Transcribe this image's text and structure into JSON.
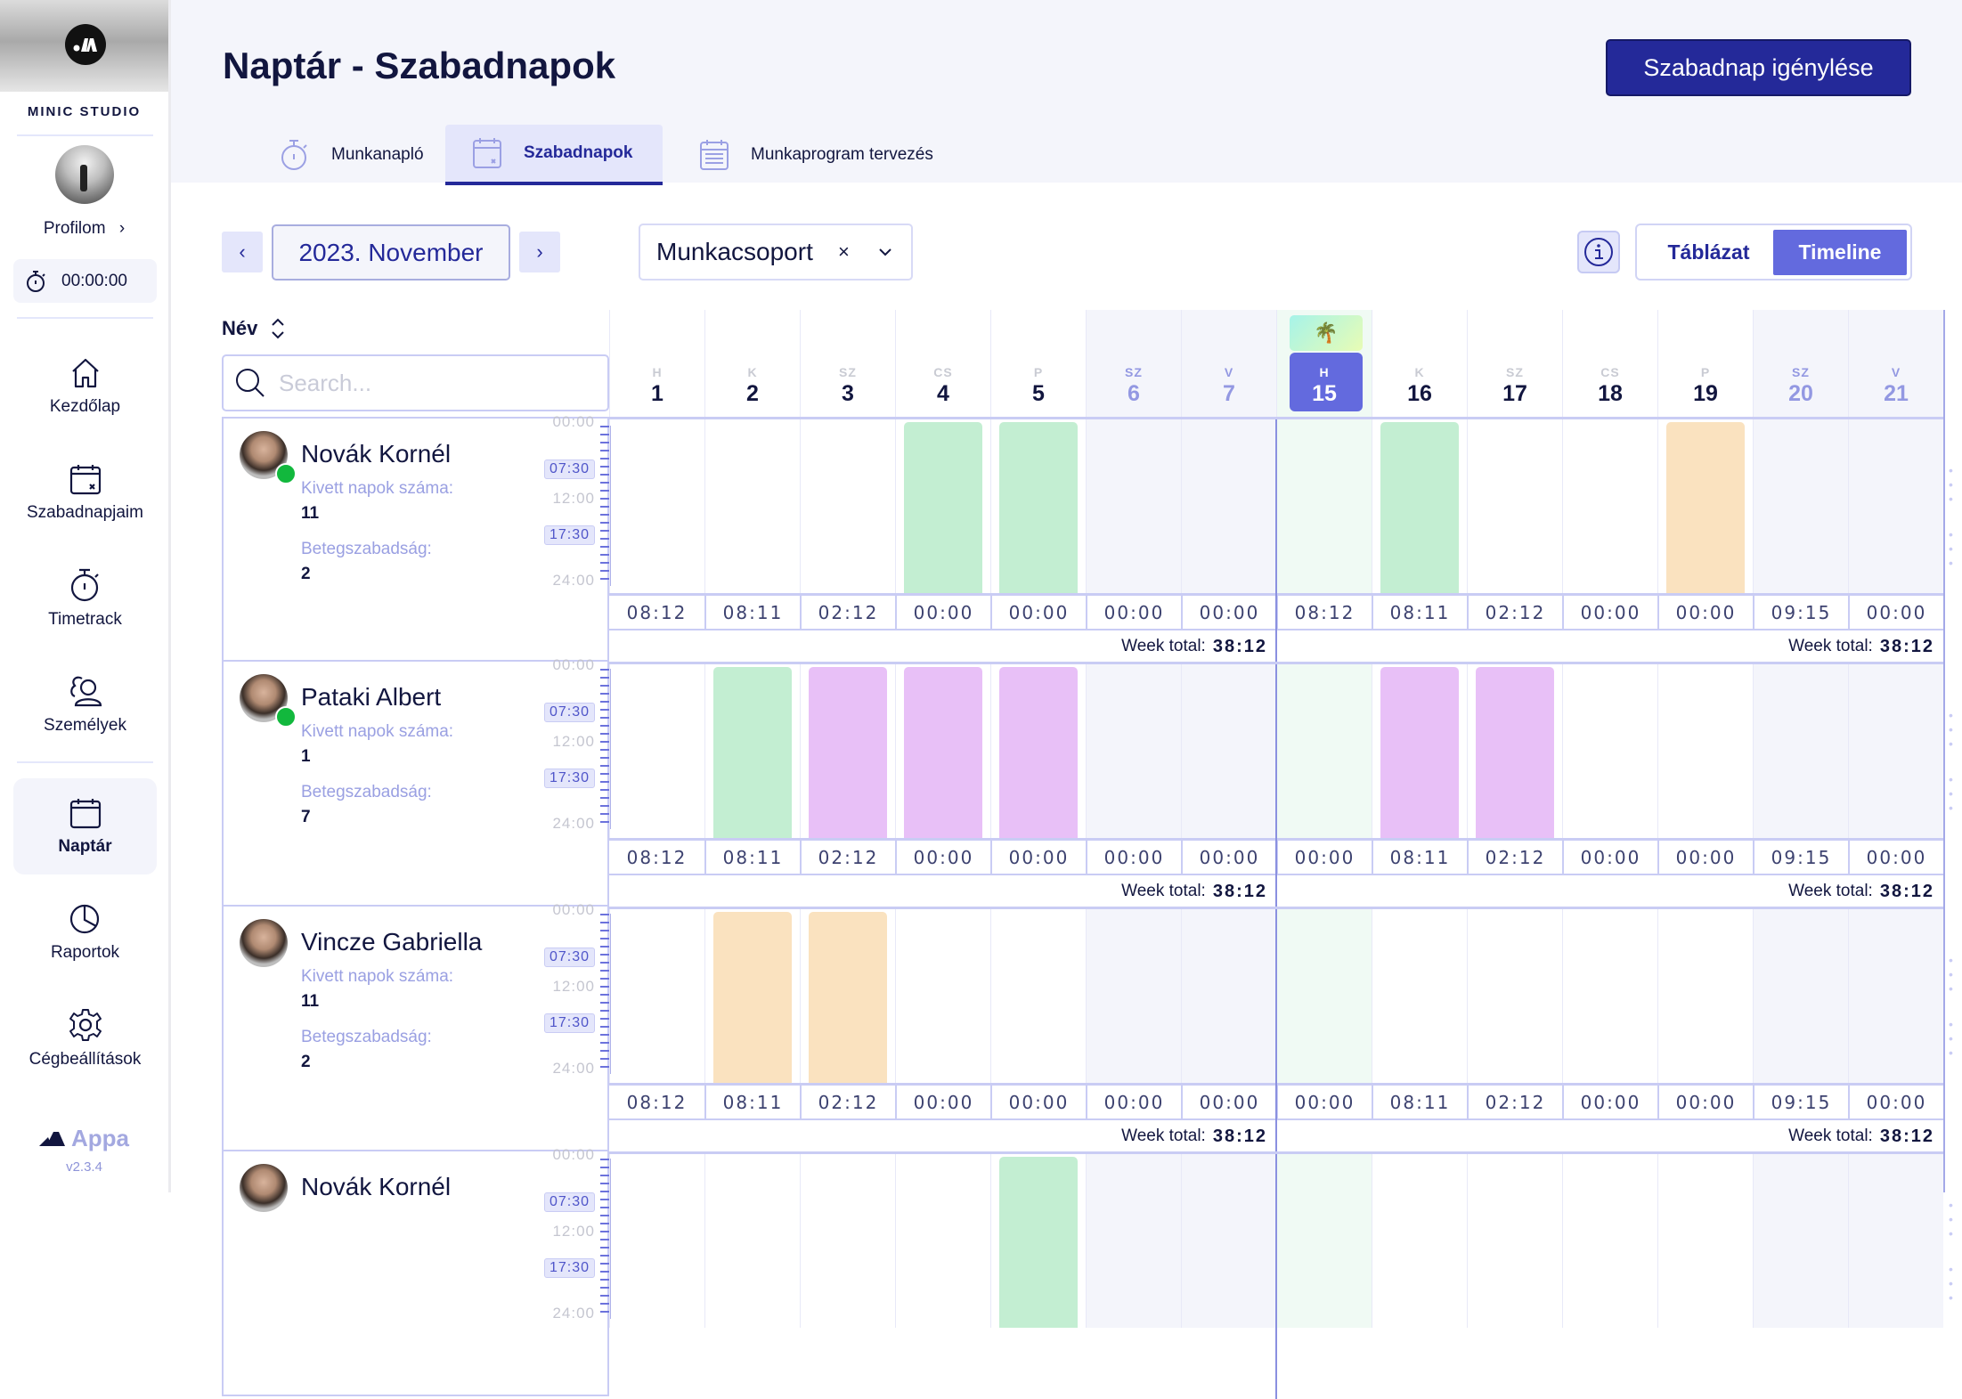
{
  "sidebar": {
    "company": "MINIC STUDIO",
    "profile_label": "Profilom",
    "timer": "00:00:00",
    "nav": [
      {
        "label": "Kezdőlap",
        "icon": "home-icon"
      },
      {
        "label": "Szabadnapjaim",
        "icon": "calendar-x-icon"
      },
      {
        "label": "Timetrack",
        "icon": "stopwatch-icon"
      },
      {
        "label": "Személyek",
        "icon": "people-icon"
      },
      {
        "label": "Naptár",
        "icon": "calendar-icon",
        "active": true
      },
      {
        "label": "Raportok",
        "icon": "pie-chart-icon"
      },
      {
        "label": "Cégbeállítások",
        "icon": "gear-icon"
      }
    ],
    "brand": "Appa",
    "version": "v2.3.4"
  },
  "header": {
    "title": "Naptár - Szabadnapok",
    "primary_button": "Szabadnap igénylése",
    "tabs": [
      {
        "label": "Munkanapló",
        "icon": "stopwatch-icon"
      },
      {
        "label": "Szabadnapok",
        "icon": "calendar-x-icon",
        "active": true
      },
      {
        "label": "Munkaprogram tervezés",
        "icon": "calendar-list-icon"
      }
    ]
  },
  "controls": {
    "prev": "‹",
    "month": "2023. November",
    "next": "›",
    "group_select": "Munkacsoport",
    "group_clear": "×",
    "view_options": [
      "Táblázat",
      "Timeline"
    ],
    "active_view": "Timeline"
  },
  "grid": {
    "name_header": "Név",
    "search_placeholder": "Search...",
    "days": [
      {
        "abbr": "H",
        "num": "1"
      },
      {
        "abbr": "K",
        "num": "2"
      },
      {
        "abbr": "SZ",
        "num": "3"
      },
      {
        "abbr": "CS",
        "num": "4"
      },
      {
        "abbr": "P",
        "num": "5"
      },
      {
        "abbr": "SZ",
        "num": "6",
        "weekend": true
      },
      {
        "abbr": "V",
        "num": "7",
        "weekend": true
      },
      {
        "abbr": "H",
        "num": "15",
        "today": true,
        "holiday": "🌴"
      },
      {
        "abbr": "K",
        "num": "16"
      },
      {
        "abbr": "SZ",
        "num": "17"
      },
      {
        "abbr": "CS",
        "num": "18"
      },
      {
        "abbr": "P",
        "num": "19"
      },
      {
        "abbr": "SZ",
        "num": "20",
        "weekend": true
      },
      {
        "abbr": "V",
        "num": "21",
        "weekend": true
      }
    ],
    "scale": {
      "start": "00:00",
      "mid": "12:00",
      "end": "24:00",
      "work_start": "07:30",
      "work_end": "17:30"
    },
    "week_total_label": "Week total:",
    "leave_colors": {
      "vacation": "#c3eed2",
      "sick": "#fae2bf",
      "other": "#e8c0f7"
    },
    "people": [
      {
        "name": "Novák Kornél",
        "online": true,
        "taken_label": "Kivett napok száma:",
        "taken": "11",
        "sick_label": "Betegszabadság:",
        "sick": "2",
        "bars": [
          "",
          "",
          "",
          "vacation",
          "vacation",
          "",
          "",
          "",
          "vacation",
          "",
          "",
          "sick",
          "",
          ""
        ],
        "hours": [
          "08:12",
          "08:11",
          "02:12",
          "00:00",
          "00:00",
          "00:00",
          "00:00",
          "08:12",
          "08:11",
          "02:12",
          "00:00",
          "00:00",
          "09:15",
          "00:00"
        ],
        "week_totals": [
          "38:12",
          "38:12"
        ]
      },
      {
        "name": "Pataki Albert",
        "online": true,
        "taken_label": "Kivett napok száma:",
        "taken": "1",
        "sick_label": "Betegszabadság:",
        "sick": "7",
        "bars": [
          "",
          "vacation",
          "other",
          "other",
          "other",
          "",
          "",
          "",
          "other",
          "other",
          "",
          "",
          "",
          ""
        ],
        "hours": [
          "08:12",
          "08:11",
          "02:12",
          "00:00",
          "00:00",
          "00:00",
          "00:00",
          "00:00",
          "08:11",
          "02:12",
          "00:00",
          "00:00",
          "09:15",
          "00:00"
        ],
        "week_totals": [
          "38:12",
          "38:12"
        ]
      },
      {
        "name": "Vincze Gabriella",
        "online": false,
        "taken_label": "Kivett napok száma:",
        "taken": "11",
        "sick_label": "Betegszabadság:",
        "sick": "2",
        "bars": [
          "",
          "sick",
          "sick",
          "",
          "",
          "",
          "",
          "",
          "",
          "",
          "",
          "",
          "",
          ""
        ],
        "hours": [
          "08:12",
          "08:11",
          "02:12",
          "00:00",
          "00:00",
          "00:00",
          "00:00",
          "00:00",
          "08:11",
          "02:12",
          "00:00",
          "00:00",
          "09:15",
          "00:00"
        ],
        "week_totals": [
          "38:12",
          "38:12"
        ]
      },
      {
        "name": "Novák Kornél",
        "online": false,
        "taken_label": "",
        "taken": "",
        "sick_label": "",
        "sick": "",
        "bars": [
          "",
          "",
          "",
          "",
          "vacation",
          "",
          "",
          "",
          "",
          "",
          "",
          "",
          "",
          ""
        ],
        "hours": [],
        "week_totals": []
      }
    ]
  }
}
